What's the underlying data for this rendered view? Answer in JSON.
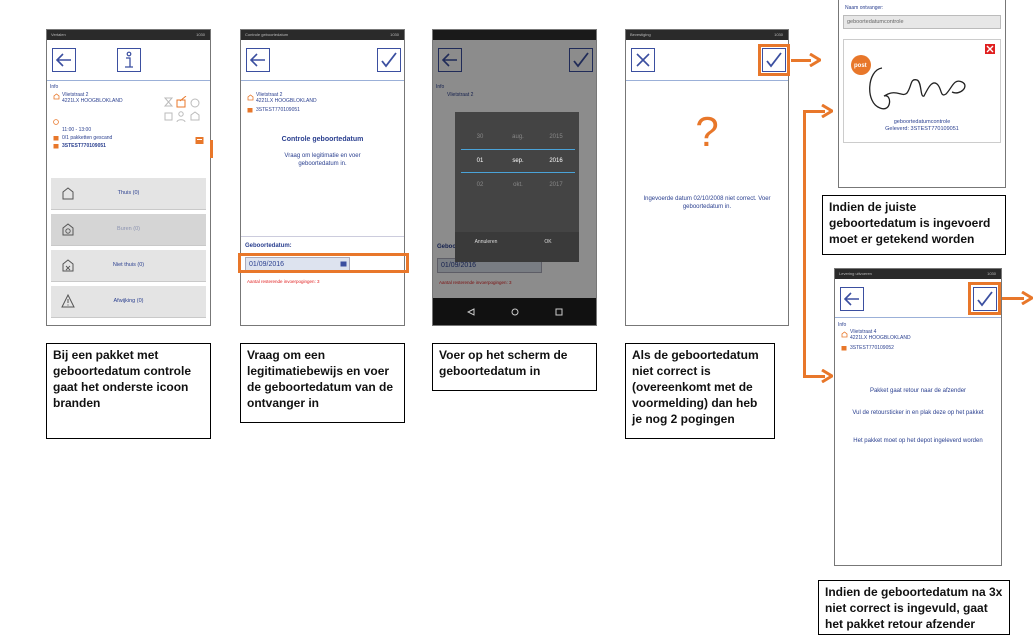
{
  "colors": {
    "accent": "#e8772a",
    "brand_blue": "#2a3f8f",
    "error_red": "#e02020"
  },
  "screen1": {
    "status_left": "Vertalen",
    "status_right": "1030",
    "back_icon": "back-arrow-icon",
    "info_icon": "info-icon",
    "info_label": "Info",
    "address_line1": "Vlietstraat 2",
    "address_line2": "4221LX HOOGBLOKLAND",
    "time_window": "11:00 - 13:00",
    "scanned": "0/1 pakketten gescand",
    "barcode": "3STEST770109051",
    "menu": [
      {
        "label": "Thuis (0)",
        "icon": "house-icon"
      },
      {
        "label": "Buren (0)",
        "icon": "neighbours-icon"
      },
      {
        "label": "Niet thuis (0)",
        "icon": "not-home-icon"
      },
      {
        "label": "Afwijking (0)",
        "icon": "warning-icon"
      }
    ]
  },
  "screen2": {
    "status_left": "Controle geboortedatum",
    "status_right": "1030",
    "address_line1": "Vlietstraat 2",
    "address_line2": "4221LX HOOGBLOKLAND",
    "barcode": "3STEST770109051",
    "title": "Controle geboortedatum",
    "instruction": "Vraag om legitimatie en voer geboortedatum in.",
    "dob_label": "Geboortedatum:",
    "dob_value": "01/09/2016",
    "attempts": "Aantal resterende invoerpogingen: 3"
  },
  "screen3": {
    "info_label": "Info",
    "address_line1": "Vlietstraat 2",
    "picker_rows": [
      [
        "30",
        "aug.",
        "2015"
      ],
      [
        "01",
        "sep.",
        "2016"
      ],
      [
        "02",
        "okt.",
        "2017"
      ]
    ],
    "cancel_label": "Annuleren",
    "ok_label": "OK",
    "dob_label": "Geboortedatum:",
    "dob_value": "01/09/2016",
    "attempts": "Aantal resterende invoerpogingen: 3"
  },
  "screen4": {
    "status_left": "Bevestiging",
    "status_right": "1030",
    "question_mark": "?",
    "message": "Ingevoerde datum 02/10/2008 niet correct. Voer geboortedatum in."
  },
  "screen5": {
    "recipient_label": "Naam ontvanger:",
    "recipient_value": "geboortedatumcontrole",
    "signature_name": "geboortedatumcontrole",
    "delivered": "Geleverd: 3STEST770109051"
  },
  "screen6": {
    "status_left": "Levering uitvoeren",
    "status_right": "1030",
    "info_label": "Info",
    "address_line1": "Vlietstraat 4",
    "address_line2": "4221LX HOOGBLOKLAND",
    "barcode": "3STEST770109052",
    "msg1": "Pakket gaat retour naar de afzender",
    "msg2": "Vul de retoursticker in en plak deze op het pakket",
    "msg3": "Het pakket moet op het depot ingeleverd worden"
  },
  "captions": {
    "c1": "Bij een pakket met geboortedatum controle gaat het onderste icoon branden",
    "c2": "Vraag om een legitimatiebewijs en voer de geboortedatum van de ontvanger in",
    "c3": "Voer op het scherm de geboortedatum in",
    "c4": "Als de geboortedatum niet correct is (overeenkomt met de voormelding) dan heb je nog 2 pogingen",
    "c5": "Indien de juiste geboortedatum is ingevoerd moet er getekend worden",
    "c6": "Indien de geboortedatum na 3x niet correct is ingevuld, gaat het pakket retour afzender"
  }
}
